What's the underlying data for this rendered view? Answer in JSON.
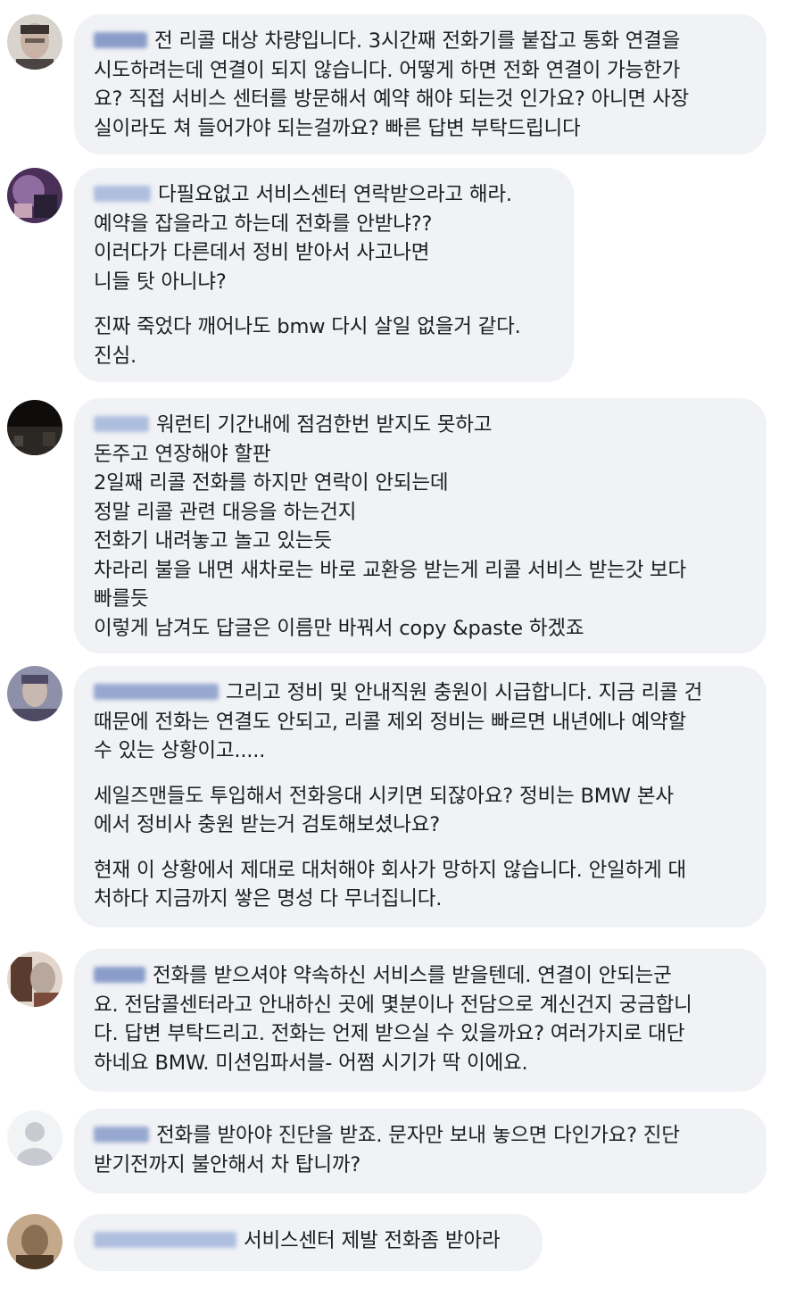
{
  "comments": [
    {
      "author": "",
      "avatar_colors": [
        "#d9d3ce",
        "#6b5e57",
        "#3a3330"
      ],
      "name_color": "#7f93c4",
      "paragraphs": [
        "전 리콜 대상 차량입니다. 3시간째 전화기를 붙잡고 통화 연결을\n시도하려는데 연결이 되지 않습니다. 어떻게 하면 전화 연결이 가능한가\n요? 직접 서비스 센터를 방문해서 예약 해야 되는것 인가요? 아니면 사장\n실이라도 쳐 들어가야 되는걸까요? 빠른 답변 부탁드립니다"
      ]
    },
    {
      "author": "",
      "avatar_colors": [
        "#8f6da0",
        "#4a2f58",
        "#c8a3b8"
      ],
      "name_color": "#a9b9dd",
      "paragraphs": [
        "다필요없고 서비스센터 연락받으라고 해라.\n예약을 잡을라고 하는데 전화를 안받냐??\n이러다가 다른데서 정비 받아서 사고나면\n니들 탓 아니냐?",
        "진짜 죽었다 깨어나도 bmw 다시 살일 없을거 같다.\n진심."
      ]
    },
    {
      "author": "",
      "avatar_colors": [
        "#2a2725",
        "#0f0d0c",
        "#4b4540"
      ],
      "name_color": "#a9b9dd",
      "paragraphs": [
        "워런티 기간내에 점검한번 받지도 못하고\n돈주고 연장해야 할판\n2일째 리콜 전화를 하지만 연락이 안되는데\n정말 리콜 관련 대응을 하는건지\n전화기 내려놓고 놀고 있는듯\n차라리 불을 내면 새차로는 바로 교환응 받는게 리콜 서비스 받는갓 보다\n빠를듯\n이렇게 남겨도 답글은 이름만 바꿔서 copy &paste 하겠죠"
      ]
    },
    {
      "author": "",
      "avatar_colors": [
        "#8e8fa8",
        "#4f4a63",
        "#c9b8b0"
      ],
      "name_color": "#8da0cc",
      "paragraphs": [
        "그리고 정비 및 안내직원 충원이 시급합니다. 지금 리콜 건\n때문에 전화는 연결도 안되고, 리콜 제외 정비는 빠르면 내년에나 예약할\n수 있는 상황이고.....",
        "세일즈맨들도 투입해서 전화응대 시키면 되잖아요? 정비는 BMW 본사\n에서 정비사 충원 받는거 검토해보셨나요?",
        "현재 이 상황에서 제대로 대처해야 회사가 망하지 않습니다. 안일하게 대\n처하다 지금까지 쌓은 명성 다 무너집니다."
      ]
    },
    {
      "author": "",
      "avatar_colors": [
        "#b8a79c",
        "#5a3b30",
        "#e2d6cd"
      ],
      "name_color": "#7f93c4",
      "paragraphs": [
        "전화를 받으셔야 약속하신 서비스를 받을텐데. 연결이 안되는군\n요. 전담콜센터라고 안내하신 곳에 몇분이나 전담으로 계신건지 궁금합니\n다. 답변 부탁드리고. 전화는 언제 받으실 수 있을까요? 여러가지로 대단\n하네요 BMW. 미션임파서블- 어쩜 시기가 딱 이에요."
      ]
    },
    {
      "author": "",
      "avatar_colors": [
        "#e4e6ea",
        "#c7cbd1",
        "#f2f3f5"
      ],
      "name_color": "#8da0cc",
      "paragraphs": [
        "전화를 받아야 진단을 받죠. 문자만 보내 놓으면 다인가요? 진단\n받기전까지 불안해서 차 탑니까?"
      ]
    },
    {
      "author": "",
      "avatar_colors": [
        "#8a6f55",
        "#4e3826",
        "#c4a88a"
      ],
      "name_color": "#a9b9dd",
      "paragraphs": [
        "서비스센터 제발 전화좀 받아라"
      ]
    }
  ]
}
